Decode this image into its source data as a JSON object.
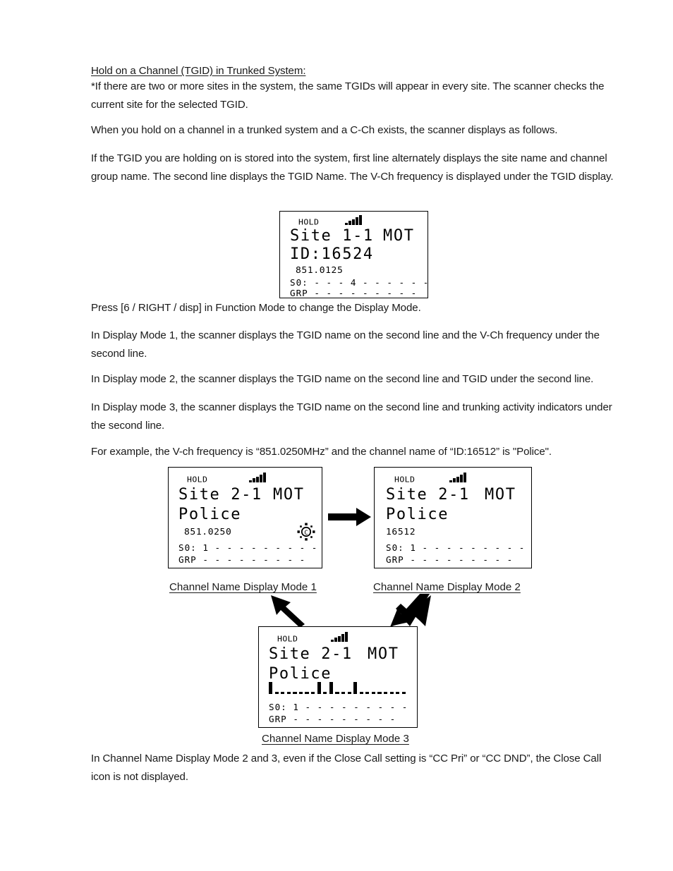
{
  "document": {
    "section_heading": "Hold on a Channel (TGID) in Trunked System:",
    "paragraphs": {
      "p1": "*If there are two or more sites in the system, the same TGIDs will appear in every site. The scanner checks the current site for the selected TGID.",
      "p2": "When you hold on a channel in a trunked system and a C-Ch exists, the scanner displays as follows.",
      "p3": "If the TGID you are holding on is stored into the system, first line alternately displays the site name and channel group name. The second line displays the TGID Name. The V-Ch frequency is displayed under the TGID display.",
      "p4": "Press [6 / RIGHT / disp] in Function Mode to change the Display Mode.",
      "p5": "In Display Mode 1, the scanner displays the TGID name on the second line and the V-Ch frequency under the second line.",
      "p6": "In Display mode 2, the scanner displays the TGID name on the second line and TGID under the second line.",
      "p7": "In Display mode 3, the scanner displays the TGID name on the second line and trunking activity indicators under the second line.",
      "p8": "For example, the V-ch frequency is “851.0250MHz” and the channel name of “ID:16512” is \"Police\".",
      "p9": "In Channel Name Display Mode 2 and 3, even if the Close Call setting is “CC Pri” or “CC DND”, the Close Call icon is not displayed."
    }
  },
  "displays": {
    "top": {
      "hold": "HOLD",
      "signal_icon": "signal-bars-icon",
      "line1": "Site 1-1",
      "system_type": "MOT",
      "line2": "ID:16524",
      "sub": "851.0125",
      "row_s0": "S0: - - - 4 - - - - - -",
      "row_grp": "GRP - - - - - - - - -"
    },
    "mode1": {
      "hold": "HOLD",
      "signal_icon": "signal-bars-icon",
      "line1": "Site 2-1",
      "system_type": "MOT",
      "line2": "Police",
      "sub": "851.0250",
      "close_call_icon": "close-call-icon",
      "row_s0": "S0: 1 - - - - - - - - -",
      "row_grp": "GRP - - - - - - - - -"
    },
    "mode2": {
      "hold": "HOLD",
      "signal_icon": "signal-bars-icon",
      "line1": "Site 2-1",
      "system_type": "MOT",
      "line2": "Police",
      "sub": "16512",
      "row_s0": "S0: 1 - - - - - - - - -",
      "row_grp": "GRP - - - - - - - - -"
    },
    "mode3": {
      "hold": "HOLD",
      "signal_icon": "signal-bars-icon",
      "line1": "Site 2-1",
      "system_type": "MOT",
      "line2": "Police",
      "activity_pattern": [
        1,
        0,
        0,
        0,
        0,
        0,
        0,
        0,
        1,
        0,
        1,
        0,
        0,
        0,
        1,
        0,
        0,
        0,
        0,
        0,
        0,
        0,
        0
      ],
      "row_s0": "S0: 1 - - - - - - - - -",
      "row_grp": "GRP - - - - - - - - -"
    }
  },
  "captions": {
    "mode1": "Channel Name Display Mode 1",
    "mode2": "Channel Name Display Mode 2",
    "mode3": "Channel Name Display Mode 3"
  },
  "colors": {
    "text": "#1a1a1a",
    "lcd_border": "#000000",
    "lcd_background": "#ffffff",
    "arrow": "#000000"
  }
}
